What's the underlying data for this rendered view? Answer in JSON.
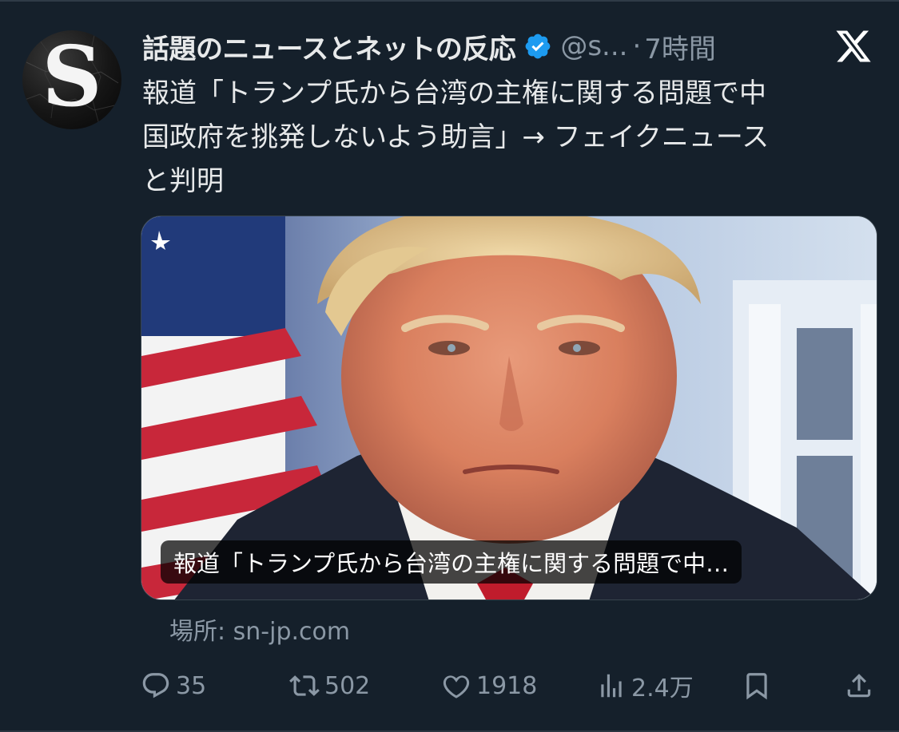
{
  "account": {
    "avatar_letter": "S",
    "display_name": "話題のニュースとネットの反応",
    "verified": true,
    "handle": "@s...",
    "separator": "·",
    "time": "7時間"
  },
  "tweet": {
    "lines": [
      "報道「トランプ氏から台湾の主権に関する問題で中",
      "国政府を挑発しないよう助言」→ フェイクニュース",
      "と判明"
    ]
  },
  "media": {
    "caption": "報道「トランプ氏から台湾の主権に関する問題で中…"
  },
  "source": {
    "text": "場所: sn-jp.com"
  },
  "actions": {
    "replies": "35",
    "reposts": "502",
    "likes": "1918",
    "views": "2.4万"
  },
  "colors": {
    "background": "#15202b",
    "text_primary": "#e7e9ea",
    "text_secondary": "#8b98a5",
    "verified_blue": "#1d9bf0"
  },
  "icons": [
    "verified-badge-icon",
    "x-logo-icon",
    "reply-icon",
    "repost-icon",
    "like-icon",
    "views-icon",
    "bookmark-icon",
    "share-icon"
  ]
}
